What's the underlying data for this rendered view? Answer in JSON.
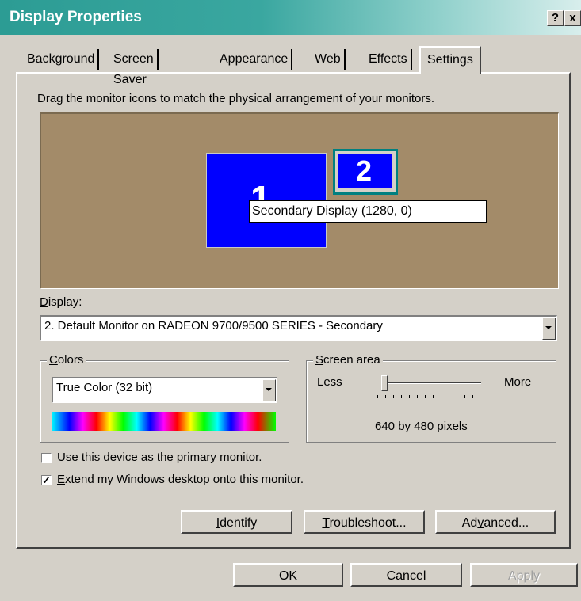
{
  "window": {
    "title": "Display Properties",
    "help_btn": "?",
    "close_btn": "x"
  },
  "tabs": [
    "Background",
    "Screen Saver",
    "Appearance",
    "Web",
    "Effects",
    "Settings"
  ],
  "active_tab": "Settings",
  "instruction": "Drag the monitor icons to match the physical arrangement of your monitors.",
  "monitors": {
    "primary_label": "1",
    "secondary_label": "2",
    "tooltip": "Secondary Display (1280, 0)"
  },
  "display": {
    "label": "Display:",
    "value": "2. Default Monitor on RADEON 9700/9500 SERIES - Secondary"
  },
  "colors": {
    "legend": "Colors",
    "value": "True Color (32 bit)"
  },
  "screen_area": {
    "legend": "Screen area",
    "less": "Less",
    "more": "More",
    "resolution": "640 by 480 pixels",
    "slider_position": 0
  },
  "checkboxes": {
    "primary": {
      "label": "Use this device as the primary monitor.",
      "checked": false
    },
    "extend": {
      "label": "Extend my Windows desktop onto this monitor.",
      "checked": true
    }
  },
  "buttons": {
    "identify": "Identify",
    "troubleshoot": "Troubleshoot...",
    "advanced": "Advanced...",
    "ok": "OK",
    "cancel": "Cancel",
    "apply": "Apply"
  },
  "colors_theme": {
    "titlebar": "#2c9c94",
    "desktop": "#a38b69",
    "monitor": "#0000ff",
    "face": "#d4d0c8"
  }
}
